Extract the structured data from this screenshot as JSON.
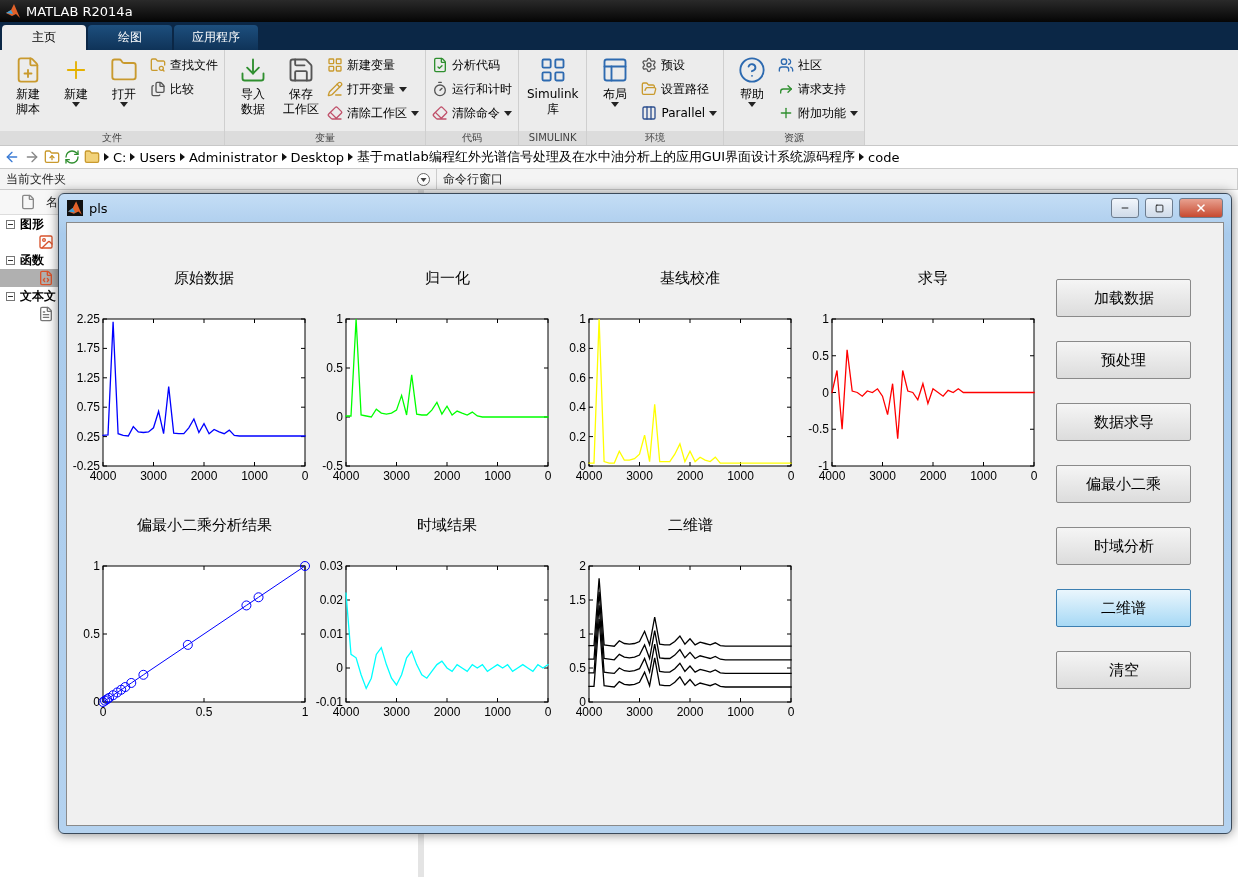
{
  "app_window": {
    "title": "MATLAB R2014a"
  },
  "ribbon_tabs": [
    {
      "label": "主页",
      "selected": true
    },
    {
      "label": "绘图",
      "selected": false
    },
    {
      "label": "应用程序",
      "selected": false
    }
  ],
  "toolstrip_groups": [
    {
      "label": "文件",
      "large": [
        {
          "lines": [
            "新建",
            "脚本"
          ],
          "menu": false
        },
        {
          "lines": [
            "新建"
          ],
          "menu": true
        },
        {
          "lines": [
            "打开"
          ],
          "menu": true
        }
      ],
      "small": [
        {
          "label": "查找文件",
          "menu": false
        },
        {
          "label": "比较",
          "menu": false
        }
      ]
    },
    {
      "label": "变量",
      "large": [
        {
          "lines": [
            "导入",
            "数据"
          ],
          "menu": false
        },
        {
          "lines": [
            "保存",
            "工作区"
          ],
          "menu": false
        }
      ],
      "small": [
        {
          "label": "新建变量",
          "menu": false
        },
        {
          "label": "打开变量",
          "menu": true
        },
        {
          "label": "清除工作区",
          "menu": true
        }
      ]
    },
    {
      "label": "代码",
      "small": [
        {
          "label": "分析代码",
          "menu": false
        },
        {
          "label": "运行和计时",
          "menu": false
        },
        {
          "label": "清除命令",
          "menu": true
        }
      ]
    },
    {
      "label": "SIMULINK",
      "large": [
        {
          "lines": [
            "Simulink",
            "库"
          ],
          "menu": false
        }
      ]
    },
    {
      "label": "环境",
      "large": [
        {
          "lines": [
            "布局"
          ],
          "menu": true
        }
      ],
      "small": [
        {
          "label": "预设",
          "menu": false
        },
        {
          "label": "设置路径",
          "menu": false
        },
        {
          "label": "Parallel",
          "menu": true
        }
      ]
    },
    {
      "label": "资源",
      "large": [
        {
          "lines": [
            "帮助"
          ],
          "menu": true
        }
      ],
      "small": [
        {
          "label": "社区",
          "menu": false
        },
        {
          "label": "请求支持",
          "menu": false
        },
        {
          "label": "附加功能",
          "menu": true
        }
      ]
    }
  ],
  "address_bar": {
    "segments": [
      "C:",
      "Users",
      "Administrator",
      "Desktop",
      "基于matlab编程红外光谱信号处理及在水中油分析上的应用GUI界面设计系统源码程序",
      "code"
    ]
  },
  "current_folder": {
    "title": "当前文件夹",
    "column_1": "名",
    "tree": [
      {
        "label": "图形",
        "expanded": true,
        "children": [
          {
            "kind": "figure",
            "selected": false
          }
        ]
      },
      {
        "label": "函数",
        "expanded": true,
        "children": [
          {
            "kind": "function",
            "selected": true
          }
        ]
      },
      {
        "label": "文本文",
        "expanded": true,
        "children": [
          {
            "kind": "text",
            "selected": false
          }
        ]
      }
    ]
  },
  "command_window": {
    "title": "命令行窗口"
  },
  "figure_window": {
    "title": "pls",
    "charts": [
      {
        "chart_data": {
          "type": "line",
          "title": "原始数据",
          "x": [
            4000,
            3900,
            3800,
            3700,
            3600,
            3500,
            3400,
            3300,
            3200,
            3100,
            3000,
            2900,
            2800,
            2700,
            2600,
            2500,
            2400,
            2300,
            2200,
            2100,
            2000,
            1900,
            1800,
            1700,
            1600,
            1500,
            1400,
            1300,
            1200,
            1100,
            1000,
            900,
            800,
            700,
            600,
            500,
            400,
            300,
            200,
            100,
            0
          ],
          "series": [
            {
              "color": "#0000ff",
              "values": [
                0.27,
                0.28,
                2.2,
                0.3,
                0.27,
                0.26,
                0.42,
                0.33,
                0.32,
                0.33,
                0.4,
                0.68,
                0.3,
                1.1,
                0.31,
                0.3,
                0.3,
                0.4,
                0.55,
                0.32,
                0.47,
                0.3,
                0.37,
                0.33,
                0.3,
                0.36,
                0.27,
                0.26,
                0.26,
                0.26,
                0.26,
                0.26,
                0.26,
                0.26,
                0.26,
                0.26,
                0.26,
                0.26,
                0.26,
                0.26,
                0.26
              ]
            }
          ],
          "xlim": [
            4000,
            0
          ],
          "ylim": [
            -0.25,
            2.25
          ],
          "xticks": [
            4000,
            3000,
            2000,
            1000,
            0
          ],
          "yticks": [
            -0.25,
            0.25,
            0.75,
            1.25,
            1.75,
            2.25
          ]
        }
      },
      {
        "chart_data": {
          "type": "line",
          "title": "归一化",
          "x": [
            4000,
            3900,
            3800,
            3700,
            3600,
            3500,
            3400,
            3300,
            3200,
            3100,
            3000,
            2900,
            2800,
            2700,
            2600,
            2500,
            2400,
            2300,
            2200,
            2100,
            2000,
            1900,
            1800,
            1700,
            1600,
            1500,
            1400,
            1300,
            1200,
            1100,
            1000,
            900,
            800,
            700,
            600,
            500,
            400,
            300,
            200,
            100,
            0
          ],
          "series": [
            {
              "color": "#00ff00",
              "values": [
                0.01,
                0.01,
                1,
                0.02,
                0.01,
                0,
                0.08,
                0.04,
                0.03,
                0.04,
                0.07,
                0.22,
                0.02,
                0.43,
                0.03,
                0.02,
                0.02,
                0.07,
                0.15,
                0.03,
                0.11,
                0.02,
                0.06,
                0.04,
                0.02,
                0.05,
                0.01,
                0,
                0,
                0,
                0,
                0,
                0,
                0,
                0,
                0,
                0,
                0,
                0,
                0,
                0
              ]
            }
          ],
          "xlim": [
            4000,
            0
          ],
          "ylim": [
            -0.5,
            1
          ],
          "xticks": [
            4000,
            3000,
            2000,
            1000,
            0
          ],
          "yticks": [
            -0.5,
            0,
            0.5,
            1
          ]
        }
      },
      {
        "chart_data": {
          "type": "line",
          "title": "基线校准",
          "x": [
            4000,
            3900,
            3800,
            3700,
            3600,
            3500,
            3400,
            3300,
            3200,
            3100,
            3000,
            2900,
            2800,
            2700,
            2600,
            2500,
            2400,
            2300,
            2200,
            2100,
            2000,
            1900,
            1800,
            1700,
            1600,
            1500,
            1400,
            1300,
            1200,
            1100,
            1000,
            900,
            800,
            700,
            600,
            500,
            400,
            300,
            200,
            100,
            0
          ],
          "series": [
            {
              "color": "#ffff00",
              "values": [
                0.02,
                0.02,
                1,
                0.03,
                0.02,
                0.02,
                0.1,
                0.04,
                0.04,
                0.05,
                0.08,
                0.21,
                0.03,
                0.42,
                0.03,
                0.03,
                0.03,
                0.08,
                0.15,
                0.03,
                0.1,
                0.03,
                0.06,
                0.04,
                0.03,
                0.06,
                0.02,
                0.02,
                0.02,
                0.02,
                0.02,
                0.02,
                0.02,
                0.02,
                0.02,
                0.02,
                0.02,
                0.02,
                0.02,
                0.02,
                0.02
              ]
            }
          ],
          "xlim": [
            4000,
            0
          ],
          "ylim": [
            0,
            1
          ],
          "xticks": [
            4000,
            3000,
            2000,
            1000,
            0
          ],
          "yticks": [
            0,
            0.2,
            0.4,
            0.6,
            0.8,
            1
          ]
        }
      },
      {
        "chart_data": {
          "type": "line",
          "title": "求导",
          "x": [
            4000,
            3900,
            3800,
            3700,
            3600,
            3500,
            3400,
            3300,
            3200,
            3100,
            3000,
            2900,
            2800,
            2700,
            2600,
            2500,
            2400,
            2300,
            2200,
            2100,
            2000,
            1900,
            1800,
            1700,
            1600,
            1500,
            1400,
            1300,
            1200,
            1100,
            1000,
            900,
            800,
            700,
            600,
            500,
            400,
            300,
            200,
            100,
            0
          ],
          "series": [
            {
              "color": "#ff0000",
              "values": [
                0,
                0.3,
                -0.5,
                0.58,
                0.02,
                0,
                -0.05,
                0.02,
                0,
                0.05,
                -0.05,
                -0.3,
                0.12,
                -0.63,
                0.3,
                0.02,
                0,
                -0.1,
                0.12,
                -0.15,
                0.05,
                0,
                -0.05,
                0.03,
                0,
                0.05,
                0,
                0,
                0,
                0,
                0,
                0,
                0,
                0,
                0,
                0,
                0,
                0,
                0,
                0,
                0
              ]
            }
          ],
          "xlim": [
            4000,
            0
          ],
          "ylim": [
            -1,
            1
          ],
          "xticks": [
            4000,
            3000,
            2000,
            1000,
            0
          ],
          "yticks": [
            -1,
            -0.5,
            0,
            0.5,
            1
          ]
        }
      },
      {
        "chart_data": {
          "type": "line",
          "title": "偏最小二乘分析结果",
          "x": [
            0,
            0.01,
            0.02,
            0.03,
            0.05,
            0.07,
            0.09,
            0.11,
            0.14,
            0.2,
            0.42,
            0.71,
            0.77,
            1
          ],
          "series": [
            {
              "color": "#0000ff",
              "marker": "o",
              "values": [
                0,
                0.01,
                0.02,
                0.03,
                0.05,
                0.07,
                0.09,
                0.11,
                0.14,
                0.2,
                0.42,
                0.71,
                0.77,
                1
              ]
            }
          ],
          "xlim": [
            0,
            1
          ],
          "ylim": [
            0,
            1
          ],
          "xticks": [
            0,
            0.5,
            1
          ],
          "yticks": [
            0,
            0.5,
            1
          ]
        }
      },
      {
        "chart_data": {
          "type": "line",
          "title": "时域结果",
          "x": [
            4000,
            3900,
            3800,
            3700,
            3600,
            3500,
            3400,
            3300,
            3200,
            3100,
            3000,
            2900,
            2800,
            2700,
            2600,
            2500,
            2400,
            2300,
            2200,
            2100,
            2000,
            1900,
            1800,
            1700,
            1600,
            1500,
            1400,
            1300,
            1200,
            1100,
            1000,
            900,
            800,
            700,
            600,
            500,
            400,
            300,
            200,
            100,
            0
          ],
          "series": [
            {
              "color": "#00ffff",
              "values": [
                0.022,
                0.004,
                0.003,
                -0.002,
                -0.006,
                -0.003,
                0.004,
                0.006,
                0.001,
                -0.003,
                -0.005,
                -0.002,
                0.003,
                0.005,
                0.001,
                -0.002,
                -0.003,
                -0.001,
                0.001,
                0.002,
                0,
                -0.001,
                0.001,
                0,
                -0.001,
                0.001,
                0,
                0.001,
                -0.001,
                0,
                0.001,
                0,
                0.001,
                -0.001,
                0,
                0.001,
                0,
                -0.001,
                0.001,
                0,
                0.001
              ]
            }
          ],
          "xlim": [
            4000,
            0
          ],
          "ylim": [
            -0.01,
            0.03
          ],
          "xticks": [
            4000,
            3000,
            2000,
            1000,
            0
          ],
          "yticks": [
            -0.01,
            0,
            0.01,
            0.02,
            0.03
          ]
        }
      },
      {
        "chart_data": {
          "type": "line",
          "title": "二维谱",
          "x": [
            4000,
            3900,
            3800,
            3700,
            3600,
            3500,
            3400,
            3300,
            3200,
            3100,
            3000,
            2900,
            2800,
            2700,
            2600,
            2500,
            2400,
            2300,
            2200,
            2100,
            2000,
            1900,
            1800,
            1700,
            1600,
            1500,
            1400,
            1300,
            1200,
            1100,
            1000,
            900,
            800,
            700,
            600,
            500,
            400,
            300,
            200,
            100,
            0
          ],
          "series": [
            {
              "color": "#000000",
              "values": [
                0.23,
                0.23,
                1.22,
                0.24,
                0.23,
                0.22,
                0.3,
                0.26,
                0.25,
                0.26,
                0.29,
                0.44,
                0.24,
                0.65,
                0.25,
                0.24,
                0.24,
                0.29,
                0.37,
                0.25,
                0.33,
                0.24,
                0.28,
                0.26,
                0.24,
                0.27,
                0.23,
                0.22,
                0.22,
                0.22,
                0.22,
                0.22,
                0.22,
                0.22,
                0.22,
                0.22,
                0.22,
                0.22,
                0.22,
                0.22,
                0.22
              ]
            },
            {
              "color": "#000000",
              "values": [
                0.43,
                0.43,
                1.42,
                0.44,
                0.43,
                0.42,
                0.5,
                0.46,
                0.45,
                0.46,
                0.49,
                0.64,
                0.44,
                0.85,
                0.45,
                0.44,
                0.44,
                0.49,
                0.57,
                0.45,
                0.53,
                0.44,
                0.48,
                0.46,
                0.44,
                0.47,
                0.43,
                0.42,
                0.42,
                0.42,
                0.42,
                0.42,
                0.42,
                0.42,
                0.42,
                0.42,
                0.42,
                0.42,
                0.42,
                0.42,
                0.42
              ]
            },
            {
              "color": "#000000",
              "values": [
                0.63,
                0.63,
                1.62,
                0.64,
                0.63,
                0.62,
                0.7,
                0.66,
                0.65,
                0.66,
                0.69,
                0.84,
                0.64,
                1.05,
                0.65,
                0.64,
                0.64,
                0.69,
                0.77,
                0.65,
                0.73,
                0.64,
                0.68,
                0.66,
                0.64,
                0.67,
                0.63,
                0.62,
                0.62,
                0.62,
                0.62,
                0.62,
                0.62,
                0.62,
                0.62,
                0.62,
                0.62,
                0.62,
                0.62,
                0.62,
                0.62
              ]
            },
            {
              "color": "#000000",
              "values": [
                0.83,
                0.83,
                1.82,
                0.84,
                0.83,
                0.82,
                0.9,
                0.86,
                0.85,
                0.86,
                0.89,
                1.04,
                0.84,
                1.25,
                0.85,
                0.84,
                0.84,
                0.89,
                0.97,
                0.85,
                0.93,
                0.84,
                0.88,
                0.86,
                0.84,
                0.87,
                0.83,
                0.82,
                0.82,
                0.82,
                0.82,
                0.82,
                0.82,
                0.82,
                0.82,
                0.82,
                0.82,
                0.82,
                0.82,
                0.82,
                0.82
              ]
            }
          ],
          "xlim": [
            4000,
            0
          ],
          "ylim": [
            0,
            2
          ],
          "xticks": [
            4000,
            3000,
            2000,
            1000,
            0
          ],
          "yticks": [
            0,
            0.5,
            1,
            1.5,
            2
          ]
        }
      }
    ],
    "buttons": [
      {
        "label": "加载数据",
        "selected": false
      },
      {
        "label": "预处理",
        "selected": false
      },
      {
        "label": "数据求导",
        "selected": false
      },
      {
        "label": "偏最小二乘",
        "selected": false
      },
      {
        "label": "时域分析",
        "selected": false
      },
      {
        "label": "二维谱",
        "selected": true
      },
      {
        "label": "清空",
        "selected": false
      }
    ]
  }
}
